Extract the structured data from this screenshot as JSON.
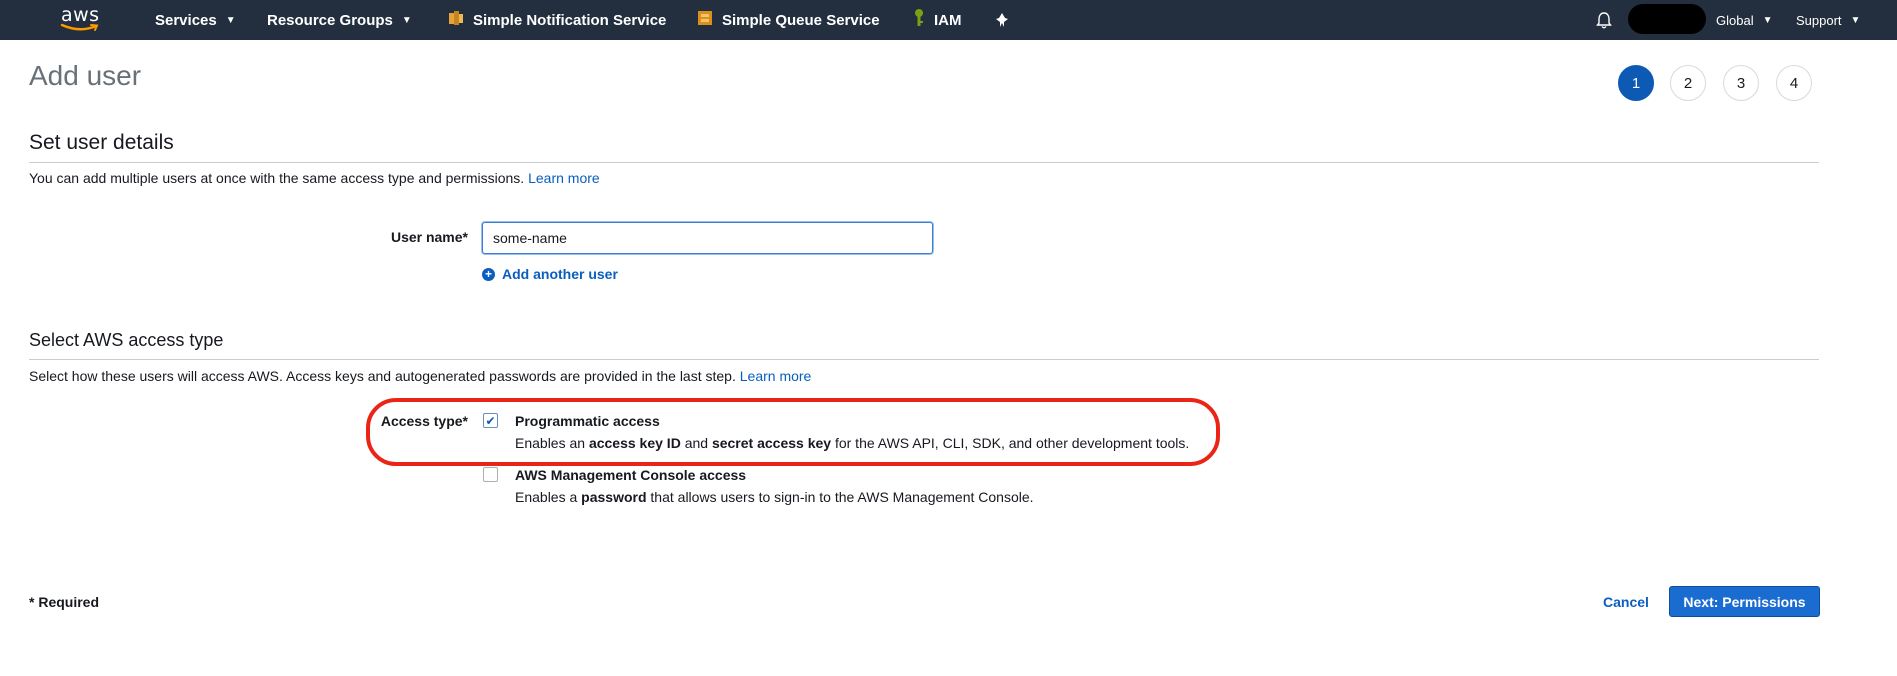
{
  "nav": {
    "logo_text": "aws",
    "services": "Services",
    "resource_groups": "Resource Groups",
    "shortcuts": [
      {
        "label": "Simple Notification Service",
        "icon": "sns-icon",
        "color": "#e7a23a"
      },
      {
        "label": "Simple Queue Service",
        "icon": "sqs-icon",
        "color": "#d9901f"
      },
      {
        "label": "IAM",
        "icon": "iam-icon",
        "color": "#7aa116"
      }
    ],
    "pin_icon": "pin-icon",
    "bell_icon": "bell-icon",
    "region": "Global",
    "support": "Support"
  },
  "page": {
    "title": "Add user",
    "steps": [
      "1",
      "2",
      "3",
      "4"
    ],
    "active_step": 1
  },
  "details": {
    "heading": "Set user details",
    "description": "You can add multiple users at once with the same access type and permissions.",
    "learn_more": "Learn more",
    "user_name_label": "User name*",
    "user_name_value": "some-name",
    "add_another": "Add another user"
  },
  "access": {
    "heading": "Select AWS access type",
    "description": "Select how these users will access AWS. Access keys and autogenerated passwords are provided in the last step.",
    "learn_more": "Learn more",
    "access_type_label": "Access type*",
    "programmatic": {
      "title": "Programmatic access",
      "checked": true,
      "desc_1": "Enables an ",
      "desc_b1": "access key ID",
      "desc_2": " and ",
      "desc_b2": "secret access key",
      "desc_3": " for the AWS API, CLI, SDK, and other development tools."
    },
    "console": {
      "title": "AWS Management Console access",
      "checked": false,
      "desc_1": "Enables a ",
      "desc_b1": "password",
      "desc_2": " that allows users to sign-in to the AWS Management Console."
    }
  },
  "footer": {
    "required": "* Required",
    "cancel": "Cancel",
    "next": "Next: Permissions"
  },
  "colors": {
    "nav_bg": "#232f3e",
    "primary": "#1b6cd1",
    "link": "#0a5ec0",
    "highlight": "#ea2516"
  }
}
